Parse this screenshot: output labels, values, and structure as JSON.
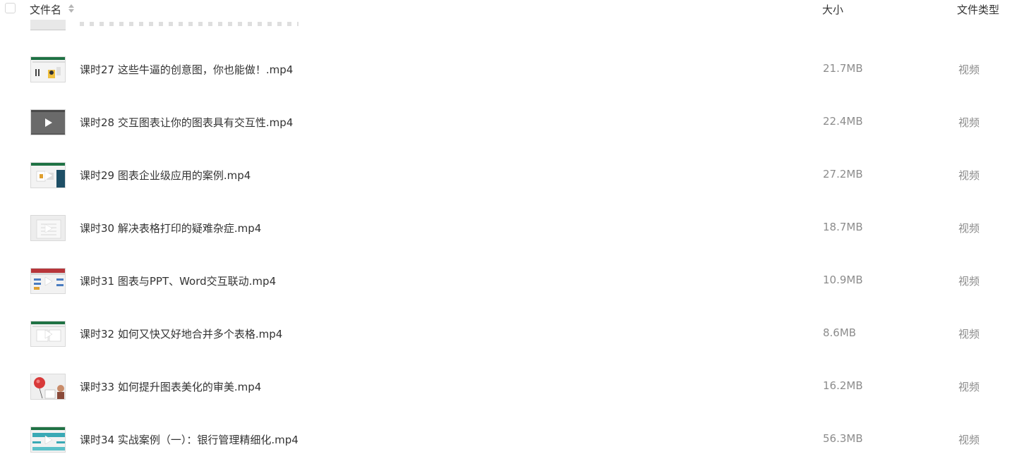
{
  "header": {
    "name_label": "文件名",
    "size_label": "大小",
    "type_label": "文件类型"
  },
  "files": [
    {
      "name": "课时27 这些牛逼的创意图，你也能做！.mp4",
      "size": "21.7MB",
      "type": "视频",
      "thumb": "creative-chart"
    },
    {
      "name": "课时28 交互图表让你的图表具有交互性.mp4",
      "size": "22.4MB",
      "type": "视频",
      "thumb": "dark-video"
    },
    {
      "name": "课时29 图表企业级应用的案例.mp4",
      "size": "27.2MB",
      "type": "视频",
      "thumb": "dashboard"
    },
    {
      "name": "课时30 解决表格打印的疑难杂症.mp4",
      "size": "18.7MB",
      "type": "视频",
      "thumb": "print-sheet"
    },
    {
      "name": "课时31 图表与PPT、Word交互联动.mp4",
      "size": "10.9MB",
      "type": "视频",
      "thumb": "ppt-word"
    },
    {
      "name": "课时32 如何又快又好地合并多个表格.mp4",
      "size": "8.6MB",
      "type": "视频",
      "thumb": "merge-tables"
    },
    {
      "name": "课时33 如何提升图表美化的审美.mp4",
      "size": "16.2MB",
      "type": "视频",
      "thumb": "balloon"
    },
    {
      "name": "课时34 实战案例（一）：银行管理精细化.mp4",
      "size": "56.3MB",
      "type": "视频",
      "thumb": "bank-case"
    }
  ]
}
